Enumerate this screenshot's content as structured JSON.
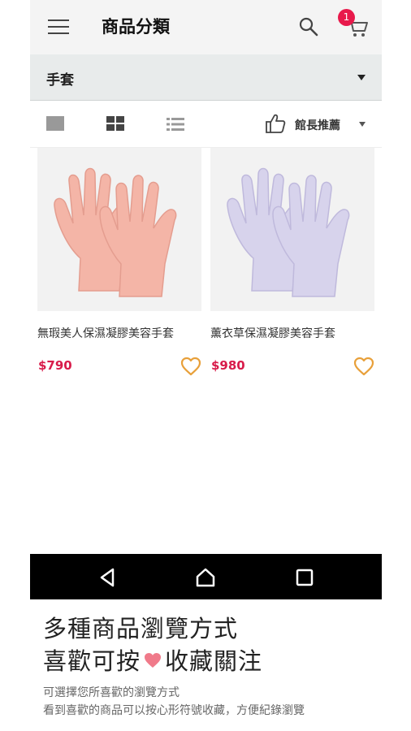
{
  "header": {
    "title": "商品分類",
    "cart_badge": "1"
  },
  "category": {
    "selected": "手套"
  },
  "toolbar": {
    "sort_label": "館長推薦"
  },
  "products": [
    {
      "name": "無瑕美人保濕凝膠美容手套",
      "price": "$790",
      "glove_color": "#f4b5a7"
    },
    {
      "name": "薰衣草保濕凝膠美容手套",
      "price": "$980",
      "glove_color": "#d7d3ec"
    }
  ],
  "colors": {
    "accent": "#d81b4a",
    "heart_outline": "#e8a03a",
    "badge": "#e8194b"
  },
  "promo": {
    "headline_1": "多種商品瀏覽方式",
    "headline_2_a": "喜歡可按",
    "headline_2_b": "收藏關注",
    "sub_1": "可選擇您所喜歡的瀏覽方式",
    "sub_2": "看到喜歡的商品可以按心形符號收藏，方便紀錄瀏覽"
  }
}
